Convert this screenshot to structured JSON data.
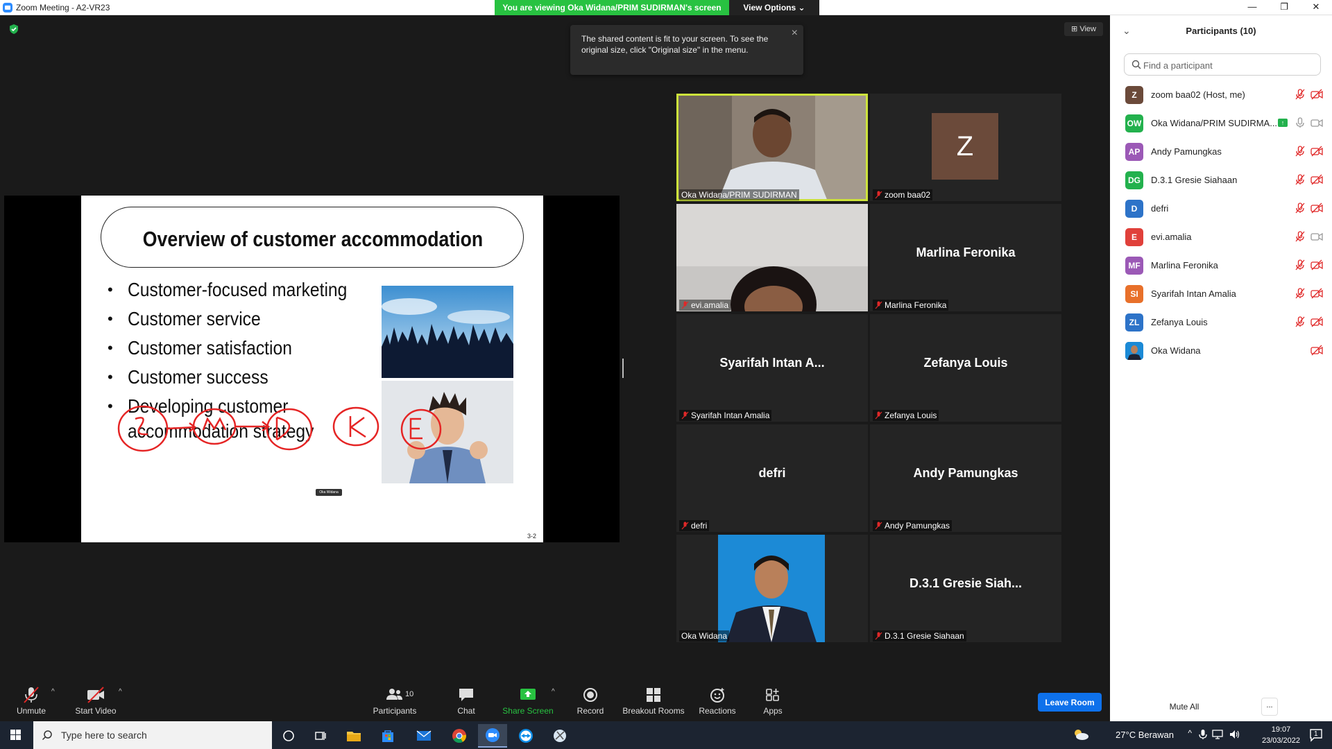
{
  "window": {
    "title": "Zoom Meeting - A2-VR23",
    "viewing_banner": "You are viewing Oka Widana/PRIM SUDIRMAN's screen",
    "view_options": "View Options",
    "view_button": "View",
    "controls": [
      "—",
      "❐",
      "✕"
    ]
  },
  "tooltip": {
    "text": "The shared content is fit to your screen. To see the original size, click \"Original size\" in the menu."
  },
  "slide": {
    "title": "Overview of customer accommodation",
    "bullets": [
      "Customer-focused marketing",
      "Customer service",
      "Customer satisfaction",
      "Customer success",
      "Developing customer",
      "accommodation strategy"
    ],
    "page": "3-2",
    "annotation_tag": "Oka Widana",
    "annotation_letters": [
      "S",
      "M",
      "D",
      "K",
      "E"
    ]
  },
  "tiles": [
    {
      "label": "Oka Widana/PRIM SUDIRMAN",
      "big": "",
      "muted": false,
      "kind": "video-man"
    },
    {
      "label": "zoom baa02",
      "big": "Z",
      "muted": true,
      "kind": "avatar"
    },
    {
      "label": "evi.amalia",
      "big": "",
      "muted": true,
      "kind": "video-woman"
    },
    {
      "label": "Marlina Feronika",
      "big": "Marlina Feronika",
      "muted": true,
      "kind": "name"
    },
    {
      "label": "Syarifah Intan Amalia",
      "big": "Syarifah  Intan  A...",
      "muted": true,
      "kind": "name"
    },
    {
      "label": "Zefanya Louis",
      "big": "Zefanya Louis",
      "muted": true,
      "kind": "name"
    },
    {
      "label": "defri",
      "big": "defri",
      "muted": true,
      "kind": "name"
    },
    {
      "label": "Andy Pamungkas",
      "big": "Andy Pamungkas",
      "muted": true,
      "kind": "name"
    },
    {
      "label": "Oka Widana",
      "big": "",
      "muted": false,
      "kind": "photo"
    },
    {
      "label": "D.3.1 Gresie Siahaan",
      "big": "D.3.1  Gresie  Siah...",
      "muted": true,
      "kind": "name"
    }
  ],
  "participants_panel": {
    "title": "Participants (10)",
    "search_placeholder": "Find a participant",
    "mute_all": "Mute All",
    "more": "...",
    "list": [
      {
        "initials": "Z",
        "color": "#6b4a3a",
        "name": "zoom baa02 (Host, me)",
        "share": false,
        "mic": "muted",
        "cam": "off"
      },
      {
        "initials": "OW",
        "color": "#23b14d",
        "name": "Oka Widana/PRIM SUDIRMA...",
        "share": true,
        "mic": "on",
        "cam": "on"
      },
      {
        "initials": "AP",
        "color": "#9b59b6",
        "name": "Andy Pamungkas",
        "share": false,
        "mic": "muted",
        "cam": "off"
      },
      {
        "initials": "DG",
        "color": "#23b14d",
        "name": "D.3.1 Gresie Siahaan",
        "share": false,
        "mic": "muted",
        "cam": "off"
      },
      {
        "initials": "D",
        "color": "#2d73c8",
        "name": "defri",
        "share": false,
        "mic": "muted",
        "cam": "off"
      },
      {
        "initials": "E",
        "color": "#e0403a",
        "name": "evi.amalia",
        "share": false,
        "mic": "muted",
        "cam": "on"
      },
      {
        "initials": "MF",
        "color": "#9b59b6",
        "name": "Marlina Feronika",
        "share": false,
        "mic": "muted",
        "cam": "off"
      },
      {
        "initials": "SI",
        "color": "#e8702a",
        "name": "Syarifah Intan Amalia",
        "share": false,
        "mic": "muted",
        "cam": "off"
      },
      {
        "initials": "ZL",
        "color": "#2d73c8",
        "name": "Zefanya Louis",
        "share": false,
        "mic": "muted",
        "cam": "off"
      },
      {
        "initials": "",
        "color": "#1b5fa8",
        "name": "Oka Widana",
        "share": false,
        "mic": "none",
        "cam": "off"
      }
    ]
  },
  "toolbar": {
    "unmute": "Unmute",
    "start_video": "Start Video",
    "participants": "Participants",
    "participants_count": "10",
    "chat": "Chat",
    "share_screen": "Share Screen",
    "record": "Record",
    "breakout_rooms": "Breakout Rooms",
    "reactions": "Reactions",
    "apps": "Apps",
    "leave": "Leave Room"
  },
  "taskbar": {
    "search_text": "Type here to search",
    "weather": "27°C  Berawan",
    "time": "19:07",
    "date": "23/03/2022",
    "notifications": "1"
  },
  "colors": {
    "zoom_blue": "#0e71eb",
    "share_green": "#28c241",
    "muted_red": "#e02828",
    "active_speaker": "#cde33b"
  }
}
